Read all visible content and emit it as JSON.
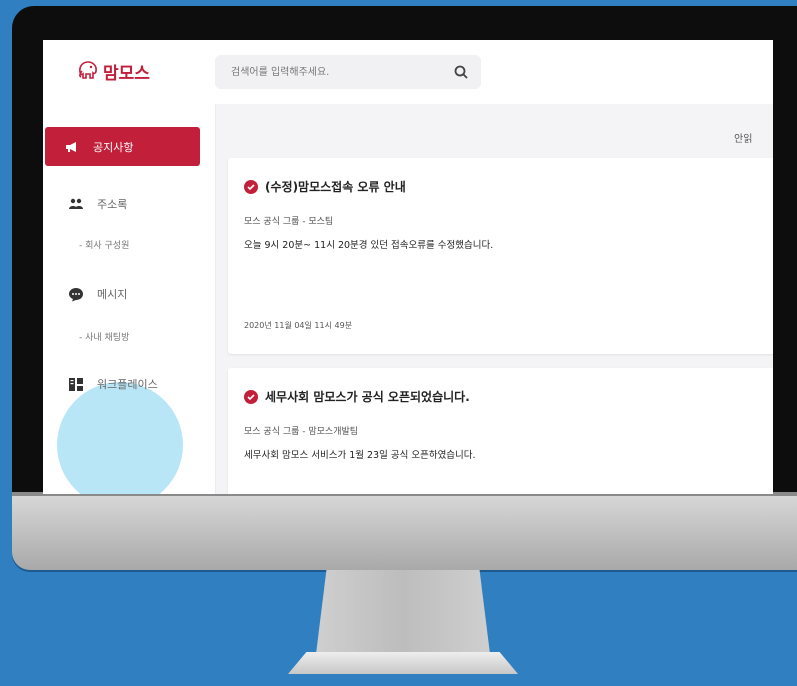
{
  "app": {
    "logo_text": "맘모스",
    "brand_color": "#c21f3a"
  },
  "search": {
    "placeholder": "검색어를 입력해주세요.",
    "icon": "search-icon"
  },
  "sidebar": {
    "active": {
      "label": "공지사항",
      "icon": "megaphone-icon"
    },
    "address": {
      "label": "주소록",
      "icon": "people-icon",
      "sub": "- 회사 구성원"
    },
    "message": {
      "label": "메시지",
      "icon": "chat-icon",
      "sub": "- 사내 채팅방"
    },
    "workplace": {
      "label": "워크플레이스",
      "icon": "workplace-icon"
    }
  },
  "content": {
    "unread_label": "안읽",
    "notices": [
      {
        "title": "(수정)맘모스접속 오류 안내",
        "group": "모스 공식 그룹 - 모스팀",
        "body": "오늘 9시 20분~ 11시 20분경 있던 접속오류를 수정했습니다.",
        "date": "2020년 11월 04일 11시 49분"
      },
      {
        "title": "세무사회 맘모스가 공식 오픈되었습니다.",
        "group": "모스 공식 그룹 - 맘모스개발팀",
        "body": "세무사회 맘모스 서비스가 1월 23일 공식 오픈하였습니다.",
        "date": ""
      }
    ]
  }
}
